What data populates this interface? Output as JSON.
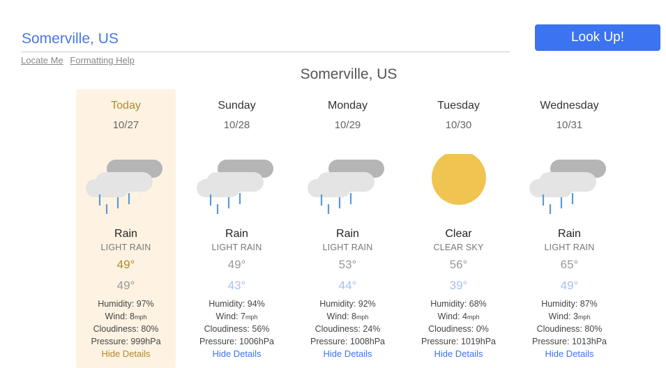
{
  "search": {
    "value": "Somerville, US"
  },
  "lookup_label": "Look Up!",
  "links": {
    "locate": "Locate Me",
    "formatting": "Formatting Help"
  },
  "location": "Somerville, US",
  "colors": {
    "accent": "#3b73f0",
    "today_bg": "#fef3e2",
    "today_text": "#b08a2e",
    "low_temp": "#a8bef0",
    "sun": "#f0c450",
    "cloud": "#b5b5b5",
    "rain": "#5a9ad6"
  },
  "days": [
    {
      "name": "Today",
      "date": "10/27",
      "icon": "rain-cloud-icon",
      "condition": "Rain",
      "description": "LIGHT RAIN",
      "high": "49°",
      "low": "49°",
      "humidity": "Humidity: 97%",
      "wind_label": "Wind: 8",
      "wind_unit": "mph",
      "cloudiness": "Cloudiness: 80%",
      "pressure": "Pressure: 999hPa",
      "hide": "Hide Details"
    },
    {
      "name": "Sunday",
      "date": "10/28",
      "icon": "rain-cloud-icon",
      "condition": "Rain",
      "description": "LIGHT RAIN",
      "high": "49°",
      "low": "43°",
      "humidity": "Humidity: 94%",
      "wind_label": "Wind: 7",
      "wind_unit": "mph",
      "cloudiness": "Cloudiness: 56%",
      "pressure": "Pressure: 1006hPa",
      "hide": "Hide Details"
    },
    {
      "name": "Monday",
      "date": "10/29",
      "icon": "rain-cloud-icon",
      "condition": "Rain",
      "description": "LIGHT RAIN",
      "high": "53°",
      "low": "44°",
      "humidity": "Humidity: 92%",
      "wind_label": "Wind: 8",
      "wind_unit": "mph",
      "cloudiness": "Cloudiness: 24%",
      "pressure": "Pressure: 1008hPa",
      "hide": "Hide Details"
    },
    {
      "name": "Tuesday",
      "date": "10/30",
      "icon": "sun-icon",
      "condition": "Clear",
      "description": "CLEAR SKY",
      "high": "56°",
      "low": "39°",
      "humidity": "Humidity: 68%",
      "wind_label": "Wind: 4",
      "wind_unit": "mph",
      "cloudiness": "Cloudiness: 0%",
      "pressure": "Pressure: 1019hPa",
      "hide": "Hide Details"
    },
    {
      "name": "Wednesday",
      "date": "10/31",
      "icon": "rain-cloud-icon",
      "condition": "Rain",
      "description": "LIGHT RAIN",
      "high": "65°",
      "low": "49°",
      "humidity": "Humidity: 87%",
      "wind_label": "Wind: 3",
      "wind_unit": "mph",
      "cloudiness": "Cloudiness: 80%",
      "pressure": "Pressure: 1013hPa",
      "hide": "Hide Details"
    }
  ]
}
